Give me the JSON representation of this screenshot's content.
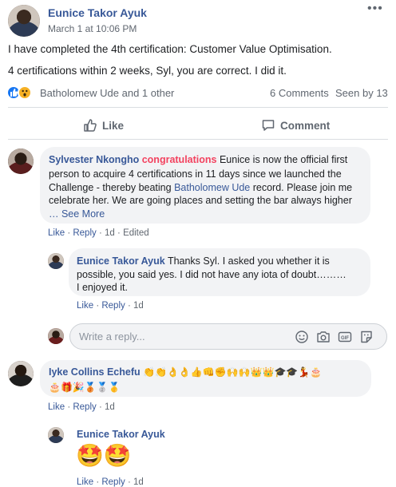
{
  "post": {
    "author": "Eunice Takor Ayuk",
    "timestamp": "March 1 at 10:06 PM",
    "text_line1": "I have completed the 4th certification: Customer Value Optimisation.",
    "text_line2": "4 certifications within 2 weeks, Syl, you are correct. I did it.",
    "more_label": "•••"
  },
  "reactions": {
    "icons": [
      "like-icon",
      "wow-icon"
    ],
    "names": "Batholomew Ude and 1 other",
    "comments": "6 Comments",
    "seen": "Seen by 13"
  },
  "actions": {
    "like": "Like",
    "comment": "Comment"
  },
  "comments": [
    {
      "author": "Sylvester Nkongho",
      "congrats": "congratulations",
      "line1": "Eunice is now the official first",
      "line2": "person to acquire 4 certifications in 11 days since we launched the",
      "line3_a": "Challenge - thereby beating ",
      "line3_link": "Batholomew Ude",
      "line3_b": " record. Please join me",
      "line4": "celebrate her. We are going places and setting the bar always higher",
      "see_more": "… See More",
      "like": "Like",
      "reply": "Reply",
      "time": "1d",
      "edited": "Edited"
    },
    {
      "author": "Eunice Takor Ayuk",
      "line1": "Thanks Syl. I asked you whether it is",
      "line2": "possible, you said yes. I did not have any iota of doubt………",
      "line3": "I enjoyed it.",
      "like": "Like",
      "reply": "Reply",
      "time": "1d"
    },
    {
      "author": "Iyke Collins Echefu",
      "emoji1": "👏👏👌👌👍👊✊🙌🙌👑👑🎓🎓💃🎂",
      "emoji2": "🎂🎁🎉🥉🥈🥇",
      "like": "Like",
      "reply": "Reply",
      "time": "1d"
    },
    {
      "author": "Eunice Takor Ayuk",
      "emoji": "🤩🤩",
      "like": "Like",
      "reply": "Reply",
      "time": "1d"
    }
  ],
  "reply": {
    "placeholder": "Write a reply...",
    "tools": [
      "smiley-icon",
      "camera-icon",
      "gif-icon",
      "sticker-icon"
    ],
    "gif_label": "GIF"
  },
  "separator": "·"
}
